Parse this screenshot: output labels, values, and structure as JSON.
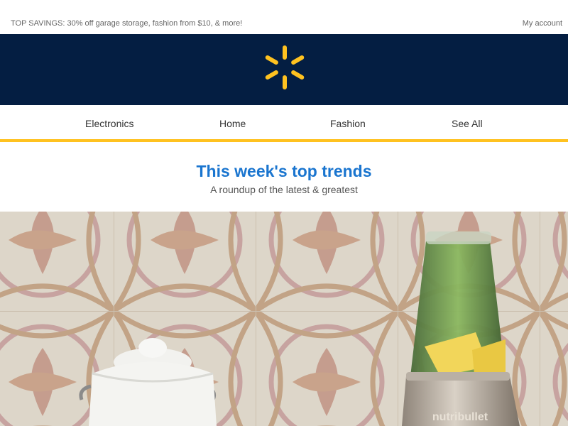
{
  "topbar": {
    "promo": "TOP SAVINGS: 30% off garage storage, fashion from $10, & more!",
    "account": "My account"
  },
  "header": {
    "logo_icon": "spark-logo-icon",
    "logo_color": "#ffc220",
    "background_color": "#041e42"
  },
  "nav": {
    "items": [
      {
        "label": "Electronics"
      },
      {
        "label": "Home"
      },
      {
        "label": "Fashion"
      },
      {
        "label": "See All"
      }
    ],
    "underline_color": "#ffc220"
  },
  "hero": {
    "title": "This week's top trends",
    "subtitle": "A roundup of the latest & greatest",
    "title_color": "#1a75cf"
  },
  "photo": {
    "blender_brand": "nutribullet"
  }
}
